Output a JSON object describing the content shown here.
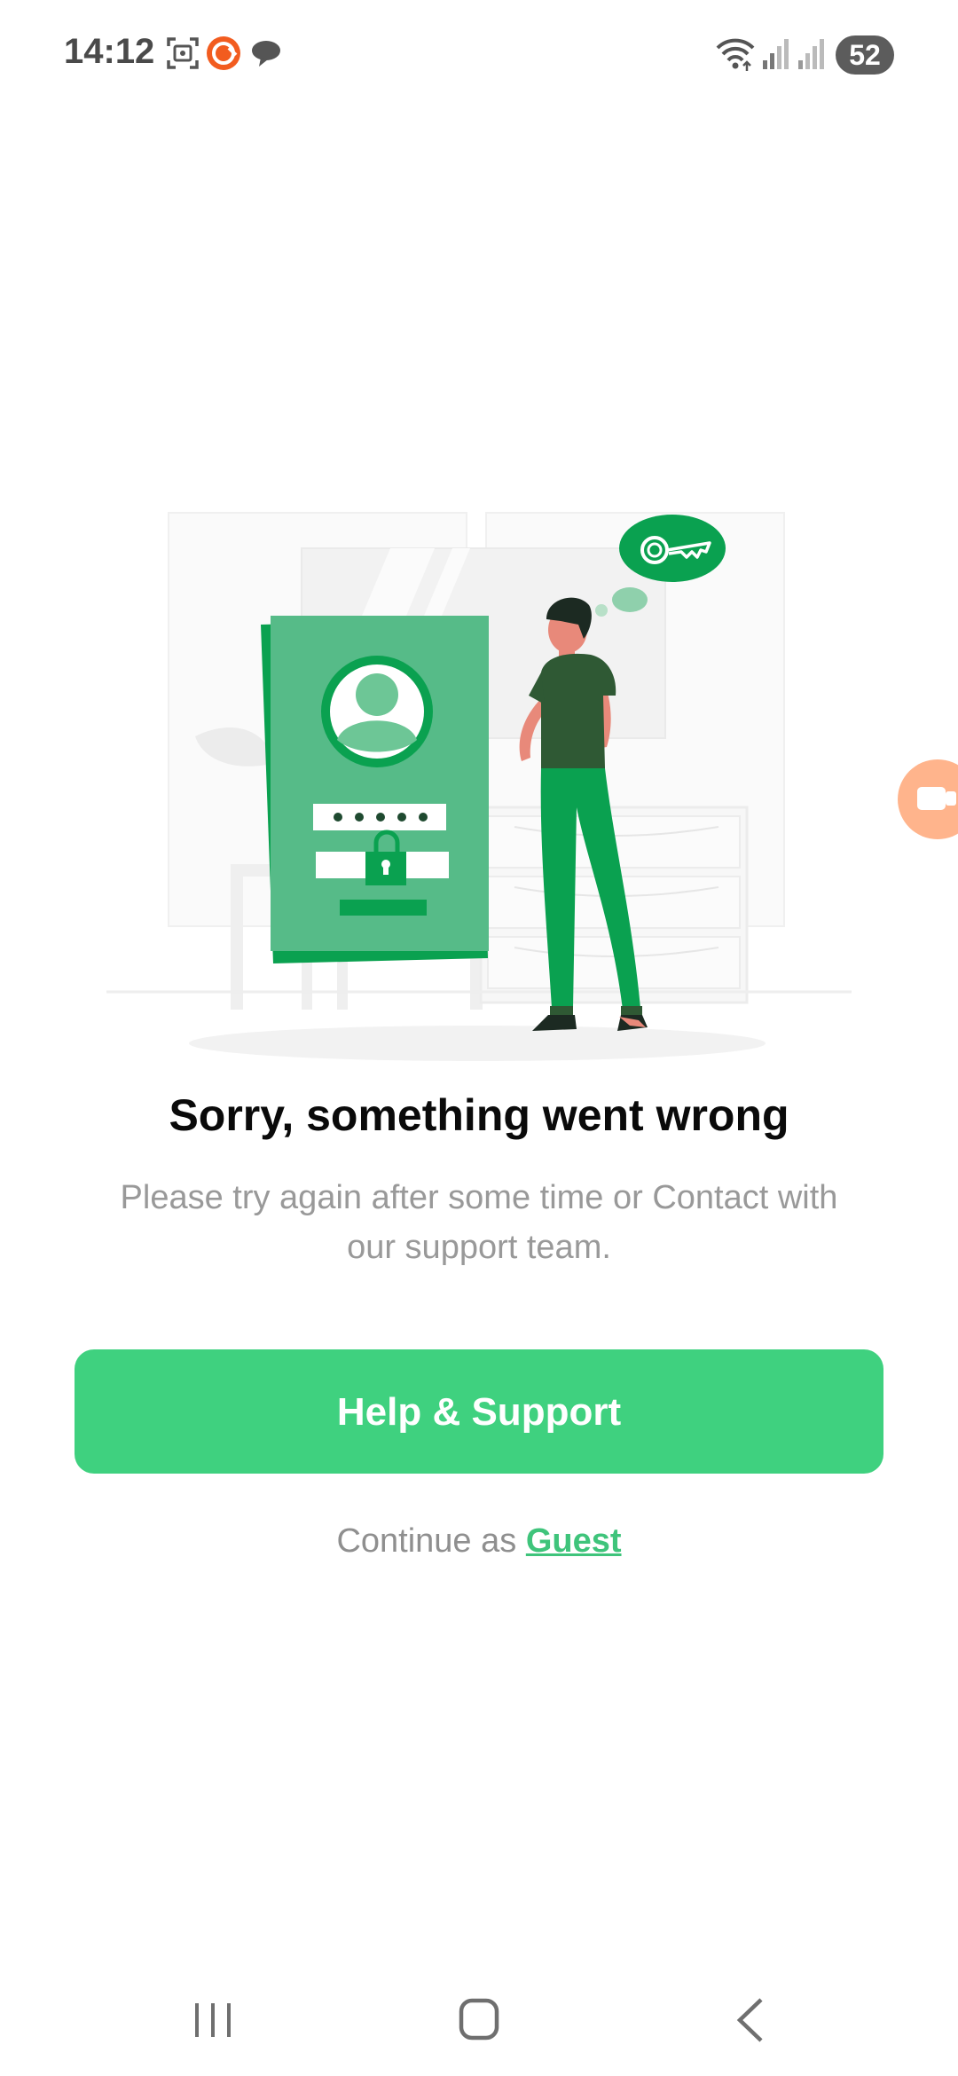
{
  "status_bar": {
    "time": "14:12",
    "battery": "52",
    "icons": [
      "screenshot-icon",
      "app-notification-icon",
      "chat-bubble-icon",
      "wifi-icon",
      "signal-icon",
      "signal-icon-2"
    ]
  },
  "error": {
    "title": "Sorry, something went wrong",
    "message": "Please try again after some time or Contact with our support team."
  },
  "actions": {
    "help_label": "Help & Support",
    "continue_prefix": "Continue as",
    "guest_label": "Guest"
  },
  "navigation": {
    "icons": [
      "recent-apps-icon",
      "home-icon",
      "back-icon"
    ]
  },
  "colors": {
    "accent": "#3fd17f",
    "illustration_green": "#0aa150",
    "text_muted": "#999999"
  }
}
